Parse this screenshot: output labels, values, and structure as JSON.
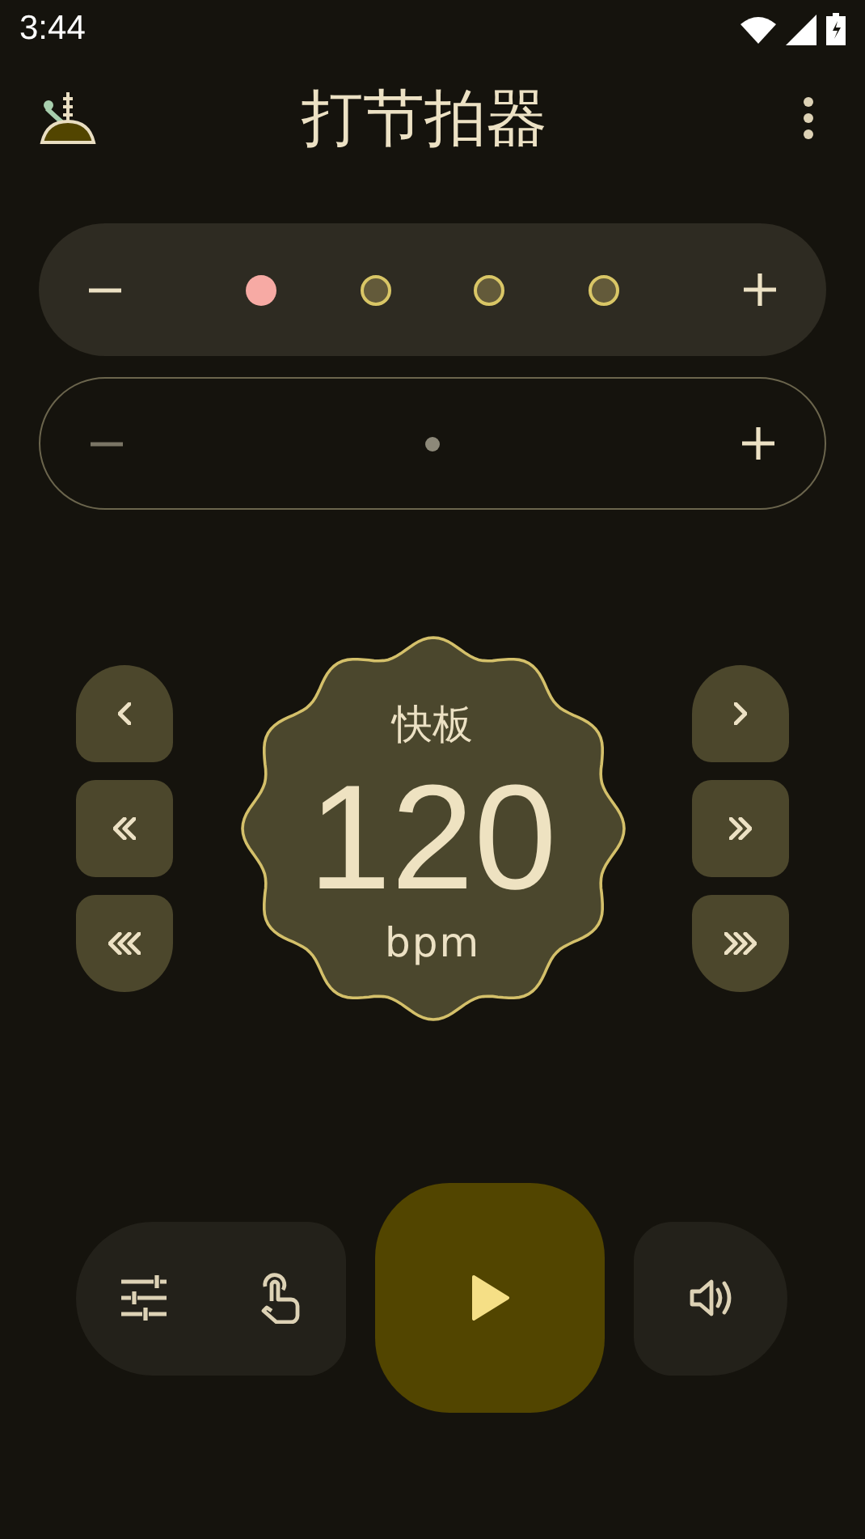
{
  "status_bar": {
    "time": "3:44"
  },
  "app_bar": {
    "title": "打节拍器"
  },
  "beats_bar": {
    "minus_disabled": false,
    "beats": [
      {
        "kind": "accent"
      },
      {
        "kind": "normal"
      },
      {
        "kind": "normal"
      },
      {
        "kind": "normal"
      }
    ]
  },
  "subdivision_bar": {
    "minus_disabled": true,
    "dots": [
      {
        "kind": "dot"
      }
    ]
  },
  "tempo": {
    "marking": "快板",
    "bpm": "120",
    "unit": "bpm"
  },
  "transport": {
    "playing": false
  }
}
